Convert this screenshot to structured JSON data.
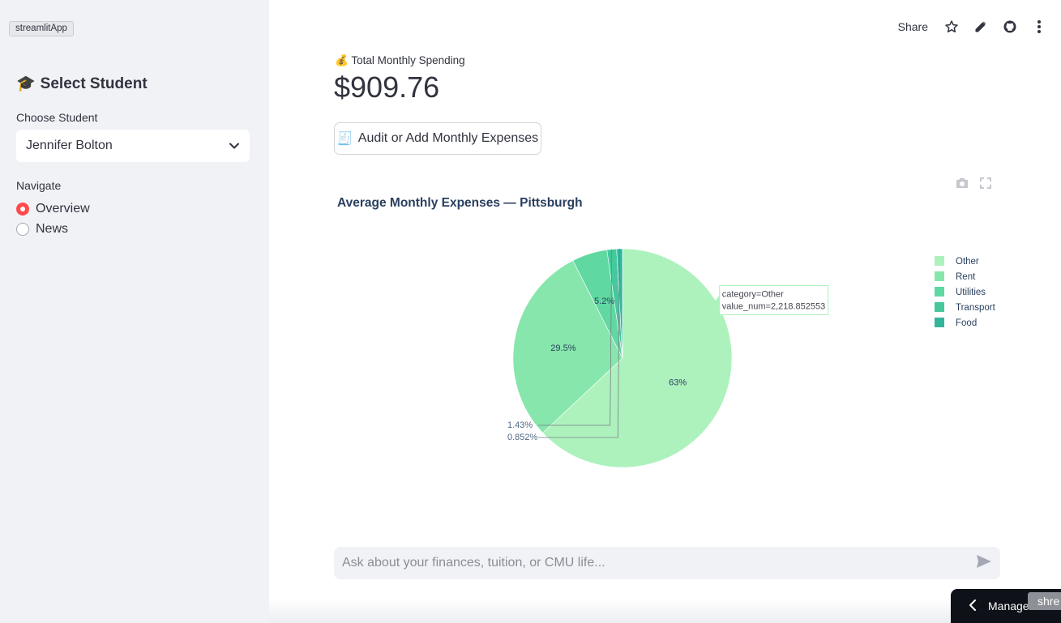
{
  "app": {
    "tag": "streamlitApp"
  },
  "sidebar": {
    "title_emoji": "🎓",
    "title": "Select Student",
    "student_label": "Choose Student",
    "student_value": "Jennifer Bolton",
    "nav_label": "Navigate",
    "nav_items": [
      {
        "label": "Overview",
        "selected": true
      },
      {
        "label": "News",
        "selected": false
      }
    ]
  },
  "toolbar": {
    "share_label": "Share"
  },
  "metric": {
    "emoji": "💰",
    "label": "Total Monthly Spending",
    "value": "$909.76"
  },
  "audit_button": {
    "emoji": "🧾",
    "label": "Audit or Add Monthly Expenses"
  },
  "chart_data": {
    "type": "pie",
    "title": "Average Monthly Expenses — Pittsburgh",
    "categories": [
      "Other",
      "Rent",
      "Utilities",
      "Transport",
      "Food"
    ],
    "values": [
      63,
      29.5,
      5.2,
      1.43,
      0.852
    ],
    "slice_labels": [
      "63%",
      "29.5%",
      "5.2%",
      "1.43%",
      "0.852%"
    ],
    "colors": [
      "#adf2bd",
      "#86e6ab",
      "#5fd8a1",
      "#45c99c",
      "#33b59c"
    ],
    "legend_placement": "top-right",
    "hover": {
      "line1": "category=Other",
      "line2": "value_num=2,218.852553"
    }
  },
  "chat": {
    "placeholder": "Ask about your finances, tuition, or CMU life..."
  },
  "footer": {
    "manage_label": "Manage",
    "user_badge": "shre"
  }
}
